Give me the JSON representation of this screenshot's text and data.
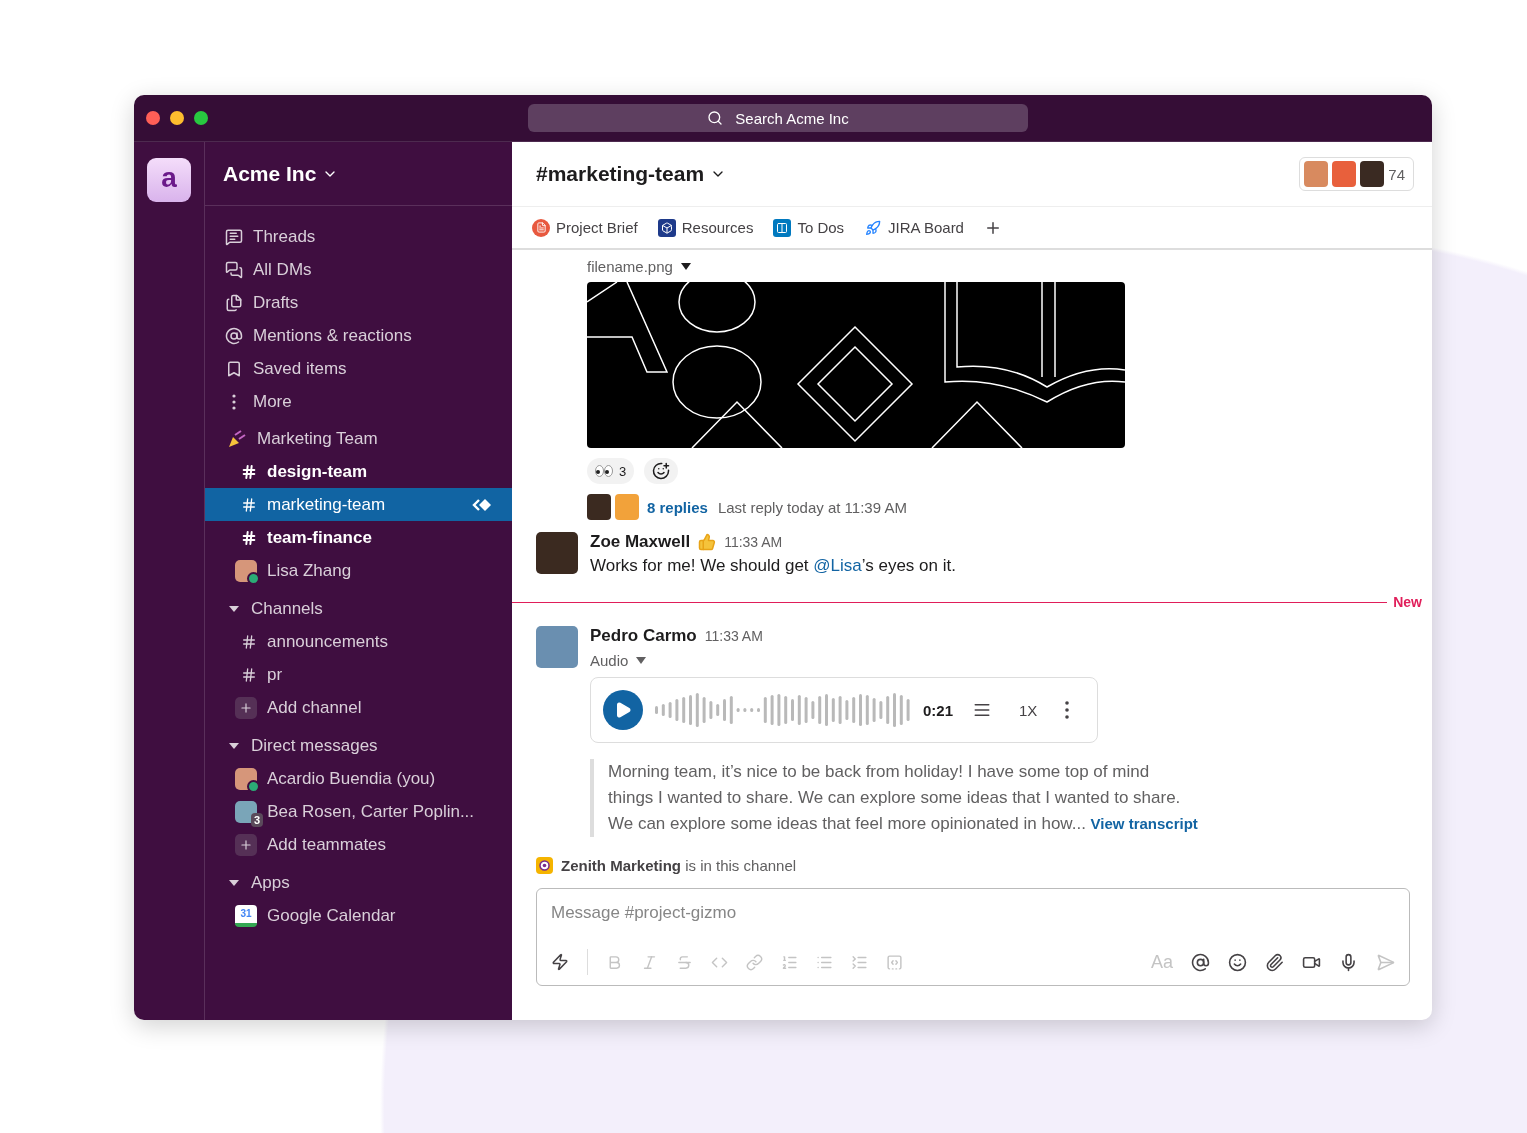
{
  "window": {
    "search_placeholder": "Search Acme Inc"
  },
  "workspace": {
    "initial": "a",
    "name": "Acme Inc"
  },
  "sidebar": {
    "nav": [
      {
        "kind": "threads",
        "label": "Threads"
      },
      {
        "kind": "dms",
        "label": "All DMs"
      },
      {
        "kind": "drafts",
        "label": "Drafts"
      },
      {
        "kind": "mentions",
        "label": "Mentions & reactions"
      },
      {
        "kind": "saved",
        "label": "Saved items"
      },
      {
        "kind": "more",
        "label": "More"
      }
    ],
    "sections": [
      {
        "kind": "emoji",
        "label": "Marketing Team",
        "expanded": true,
        "items": [
          {
            "kind": "channel",
            "label": "design-team",
            "unread": true,
            "selected": false
          },
          {
            "kind": "channel",
            "label": "marketing-team",
            "unread": false,
            "selected": true
          },
          {
            "kind": "channel",
            "label": "team-finance",
            "unread": true,
            "selected": false
          },
          {
            "kind": "dm",
            "label": "Lisa Zhang",
            "online": true,
            "selected": false
          }
        ]
      },
      {
        "kind": "collapsible",
        "label": "Channels",
        "expanded": true,
        "items": [
          {
            "kind": "channel",
            "label": "announcements",
            "unread": false,
            "selected": false
          },
          {
            "kind": "channel",
            "label": "pr",
            "unread": false,
            "selected": false
          },
          {
            "kind": "add",
            "label": "Add channel"
          }
        ]
      },
      {
        "kind": "collapsible",
        "label": "Direct messages",
        "expanded": true,
        "items": [
          {
            "kind": "dm",
            "label": "Acardio Buendia (you)",
            "online": true,
            "selected": false
          },
          {
            "kind": "group",
            "label": "Bea Rosen, Carter Poplin...",
            "count": "3"
          },
          {
            "kind": "add",
            "label": "Add teammates"
          }
        ]
      },
      {
        "kind": "collapsible",
        "label": "Apps",
        "expanded": true,
        "items": [
          {
            "kind": "app",
            "label": "Google Calendar",
            "badge": "31"
          }
        ]
      }
    ]
  },
  "channel": {
    "name": "#marketing-team",
    "member_count": "74",
    "bookmarks": [
      {
        "kind": "doc",
        "label": "Project Brief"
      },
      {
        "kind": "dropbox",
        "label": "Resources"
      },
      {
        "kind": "trello",
        "label": "To Dos"
      },
      {
        "kind": "jira",
        "label": "JIRA Board"
      }
    ]
  },
  "file": {
    "filename": "filename.png",
    "reactions": [
      {
        "count": "3"
      }
    ],
    "thread": {
      "replies": "8 replies",
      "last_reply": "Last reply today at 11:39 AM"
    }
  },
  "messages": [
    {
      "kind": "text",
      "author": "Zoe Maxwell",
      "time": "11:33 AM",
      "parts": [
        {
          "kind": "plain",
          "text": "Works for me! We should get "
        },
        {
          "kind": "mention",
          "text": "@Lisa"
        },
        {
          "kind": "plain",
          "text": "’s eyes on it."
        }
      ]
    },
    {
      "kind": "divider",
      "label": "New"
    },
    {
      "kind": "audio",
      "author": "Pedro Carmo",
      "time": "11:33 AM",
      "attachment": "Audio",
      "duration": "0:21",
      "speed": "1X",
      "transcript": "Morning team, it’s nice to be back from holiday! I have some top of mind things I wanted to share. We can explore some ideas that I wanted to share. We can explore some ideas that feel more opinionated in how...",
      "transcript_link": "View transcript"
    }
  ],
  "notice": "**Zenith Marketing** is in this channel",
  "composer": {
    "placeholder": "Message #project-gizmo",
    "format_label": "Aa"
  }
}
